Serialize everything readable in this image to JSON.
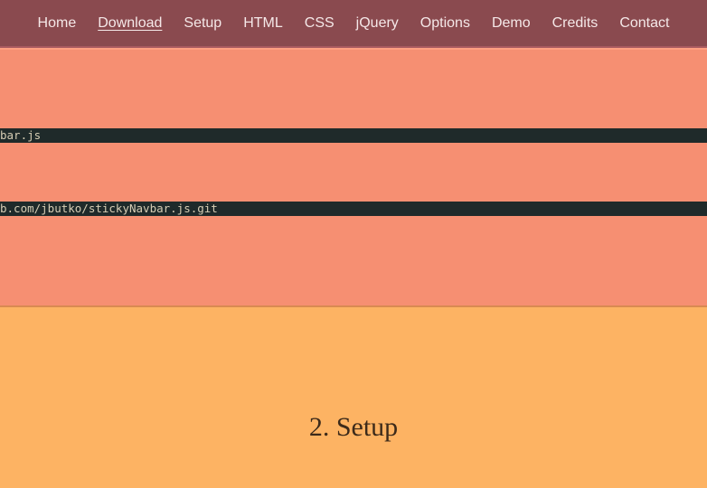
{
  "nav": {
    "items": [
      {
        "label": "Home",
        "id": "home",
        "active": false
      },
      {
        "label": "Download",
        "id": "download",
        "active": true
      },
      {
        "label": "Setup",
        "id": "setup",
        "active": false
      },
      {
        "label": "HTML",
        "id": "html",
        "active": false
      },
      {
        "label": "CSS",
        "id": "css",
        "active": false
      },
      {
        "label": "jQuery",
        "id": "jquery",
        "active": false
      },
      {
        "label": "Options",
        "id": "options",
        "active": false
      },
      {
        "label": "Demo",
        "id": "demo",
        "active": false
      },
      {
        "label": "Credits",
        "id": "credits",
        "active": false
      },
      {
        "label": "Contact",
        "id": "contact",
        "active": false
      }
    ]
  },
  "download": {
    "code_line_1": "bar.js",
    "code_line_2": "b.com/jbutko/stickyNavbar.js.git"
  },
  "setup": {
    "heading": "2. Setup"
  },
  "colors": {
    "navbar_bg": "#8a4a4f",
    "download_bg": "#f68f72",
    "setup_bg": "#fdb363",
    "code_bg": "#1f2a2a",
    "code_fg": "#d6cdb4"
  }
}
